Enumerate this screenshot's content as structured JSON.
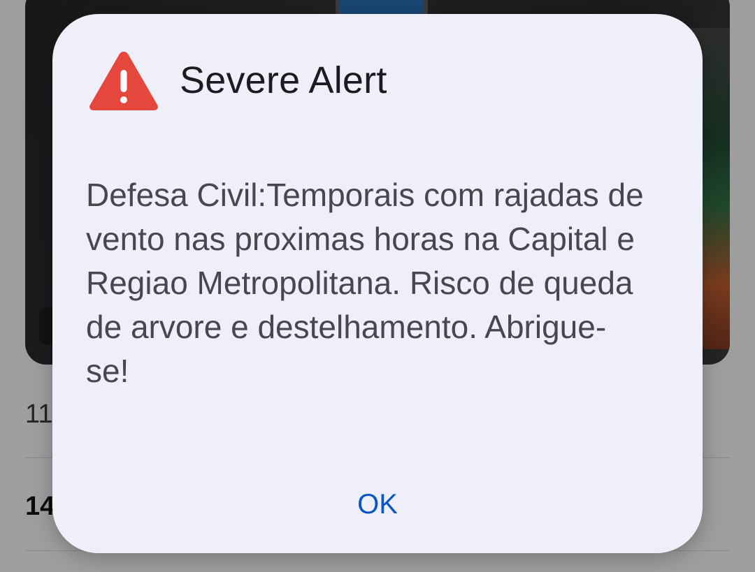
{
  "background": {
    "rows": [
      {
        "text": "11"
      },
      {
        "text": "14"
      }
    ]
  },
  "alert": {
    "title": "Severe Alert",
    "icon": "warning-triangle-icon",
    "icon_color": "#e5473c",
    "message": "Defesa Civil:Temporais com rajadas de vento nas proximas horas na Capital e Regiao Metropolitana. Risco de queda de arvore e destelhamento. Abrigue-se!",
    "ok_label": "OK",
    "ok_color": "#0a56c2"
  }
}
